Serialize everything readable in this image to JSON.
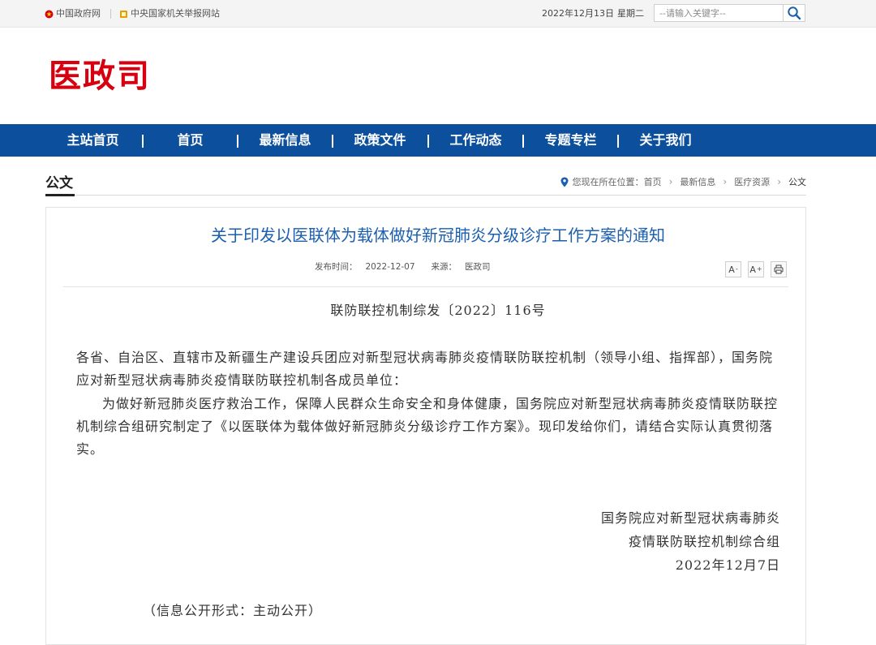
{
  "topbar": {
    "links": [
      {
        "label": "中国政府网",
        "icon": "national-emblem-icon"
      },
      {
        "label": "中央国家机关举报网站",
        "icon": "report-emblem-icon"
      }
    ],
    "date": "2022年12月13日",
    "weekday": "星期二",
    "search_placeholder": "--请输入关键字--",
    "search_icon": "search-icon"
  },
  "header": {
    "site_name": "医政司",
    "brand_color": "#d7000f"
  },
  "nav": {
    "bg_color": "#0c4f9d",
    "items": [
      "主站首页",
      "首页",
      "最新信息",
      "政策文件",
      "工作动态",
      "专题专栏",
      "关于我们"
    ]
  },
  "section": {
    "title": "公文"
  },
  "breadcrumb": {
    "prefix": "您现在所在位置：",
    "items": [
      "首页",
      "最新信息",
      "医疗资源",
      "公文"
    ],
    "icon": "location-pin-icon"
  },
  "article": {
    "title": "关于印发以医联体为载体做好新冠肺炎分级诊疗工作方案的通知",
    "title_color": "#1b5fae",
    "publish_label": "发布时间：",
    "publish_date": "2022-12-07",
    "source_label": "来源：",
    "source": "医政司",
    "tools": {
      "font_down": "A",
      "font_down_mark": "-",
      "font_up": "A",
      "font_up_mark": "+",
      "print_icon": "print-icon"
    },
    "doc_number": "联防联控机制综发〔2022〕116号",
    "addressee": "各省、自治区、直辖市及新疆生产建设兵团应对新型冠状病毒肺炎疫情联防联控机制（领导小组、指挥部），国务院应对新型冠状病毒肺炎疫情联防联控机制各成员单位：",
    "paragraph": "为做好新冠肺炎医疗救治工作，保障人民群众生命安全和身体健康，国务院应对新型冠状病毒肺炎疫情联防联控机制综合组研究制定了《以医联体为载体做好新冠肺炎分级诊疗工作方案》。现印发给你们，请结合实际认真贯彻落实。",
    "signature": {
      "line1": "国务院应对新型冠状病毒肺炎",
      "line2": "疫情联防联控机制综合组",
      "date": "2022年12月7日"
    },
    "disclosure": "（信息公开形式：主动公开）"
  }
}
